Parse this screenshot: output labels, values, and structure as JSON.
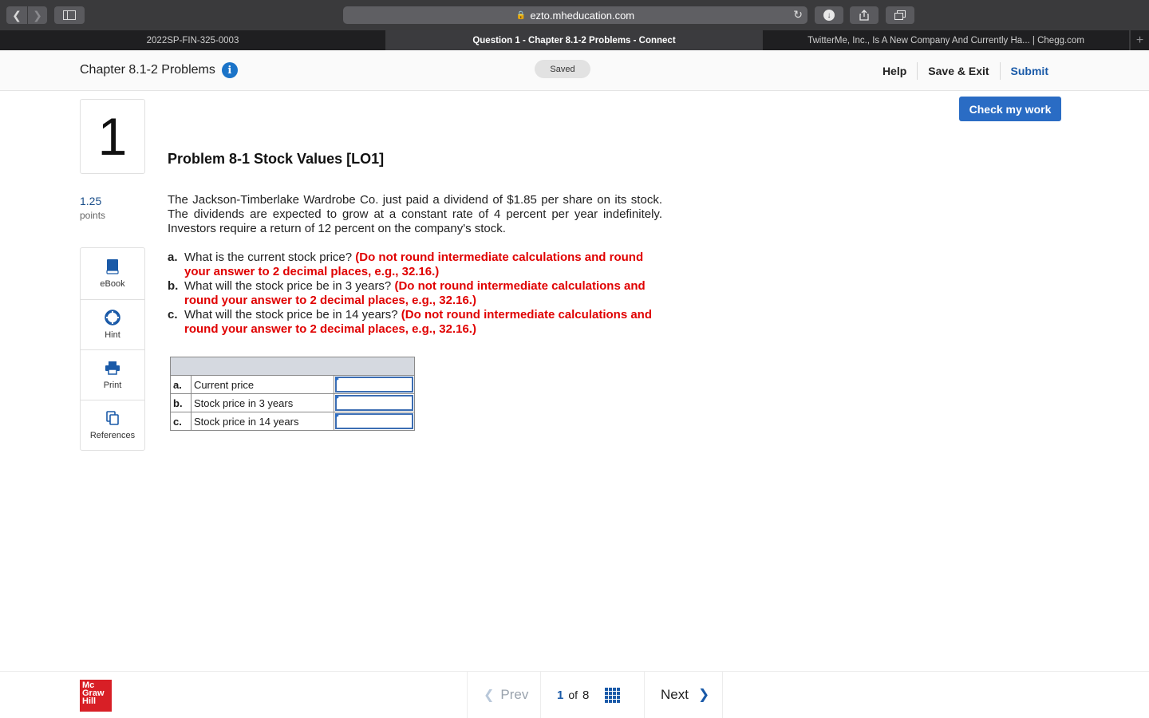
{
  "browser": {
    "url": "ezto.mheducation.com",
    "tabs": [
      {
        "label": "2022SP-FIN-325-0003"
      },
      {
        "label": "Question 1 - Chapter 8.1-2 Problems - Connect"
      },
      {
        "label": "TwitterMe, Inc., Is A New Company And Currently Ha... | Chegg.com"
      }
    ]
  },
  "header": {
    "title": "Chapter 8.1-2 Problems",
    "saved": "Saved",
    "help": "Help",
    "save_exit": "Save & Exit",
    "submit": "Submit"
  },
  "question": {
    "number": "1",
    "points": "1.25",
    "points_label": "points",
    "title": "Problem 8-1 Stock Values [LO1]",
    "body": "The Jackson-Timberlake Wardrobe Co. just paid a dividend of $1.85 per share on its stock. The dividends are expected to grow at a constant rate of 4 percent per year indefinitely. Investors require a return of 12 percent on the company's stock.",
    "parts": [
      {
        "letter": "a.",
        "text": "What is the current stock price?",
        "note": "(Do not round intermediate calculations and round your answer to 2 decimal places, e.g., 32.16.)"
      },
      {
        "letter": "b.",
        "text": "What will the stock price be in 3 years?",
        "note": "(Do not round intermediate calculations and round your answer to 2 decimal places, e.g., 32.16.)"
      },
      {
        "letter": "c.",
        "text": "What will the stock price be in 14 years?",
        "note": "(Do not round intermediate calculations and round your answer to 2 decimal places, e.g., 32.16.)"
      }
    ],
    "answer_rows": [
      {
        "letter": "a.",
        "label": "Current price",
        "value": ""
      },
      {
        "letter": "b.",
        "label": "Stock price in 3 years",
        "value": ""
      },
      {
        "letter": "c.",
        "label": "Stock price in 14 years",
        "value": ""
      }
    ]
  },
  "tools": {
    "ebook": "eBook",
    "hint": "Hint",
    "print": "Print",
    "references": "References"
  },
  "check_button": "Check my work",
  "footer": {
    "logo": [
      "Mc",
      "Graw",
      "Hill"
    ],
    "prev": "Prev",
    "current_page": "1",
    "of": "of",
    "total_pages": "8",
    "next": "Next"
  },
  "colors": {
    "accent": "#2a6cc4",
    "warning_text": "#e00000",
    "logo_red": "#d81f26"
  }
}
